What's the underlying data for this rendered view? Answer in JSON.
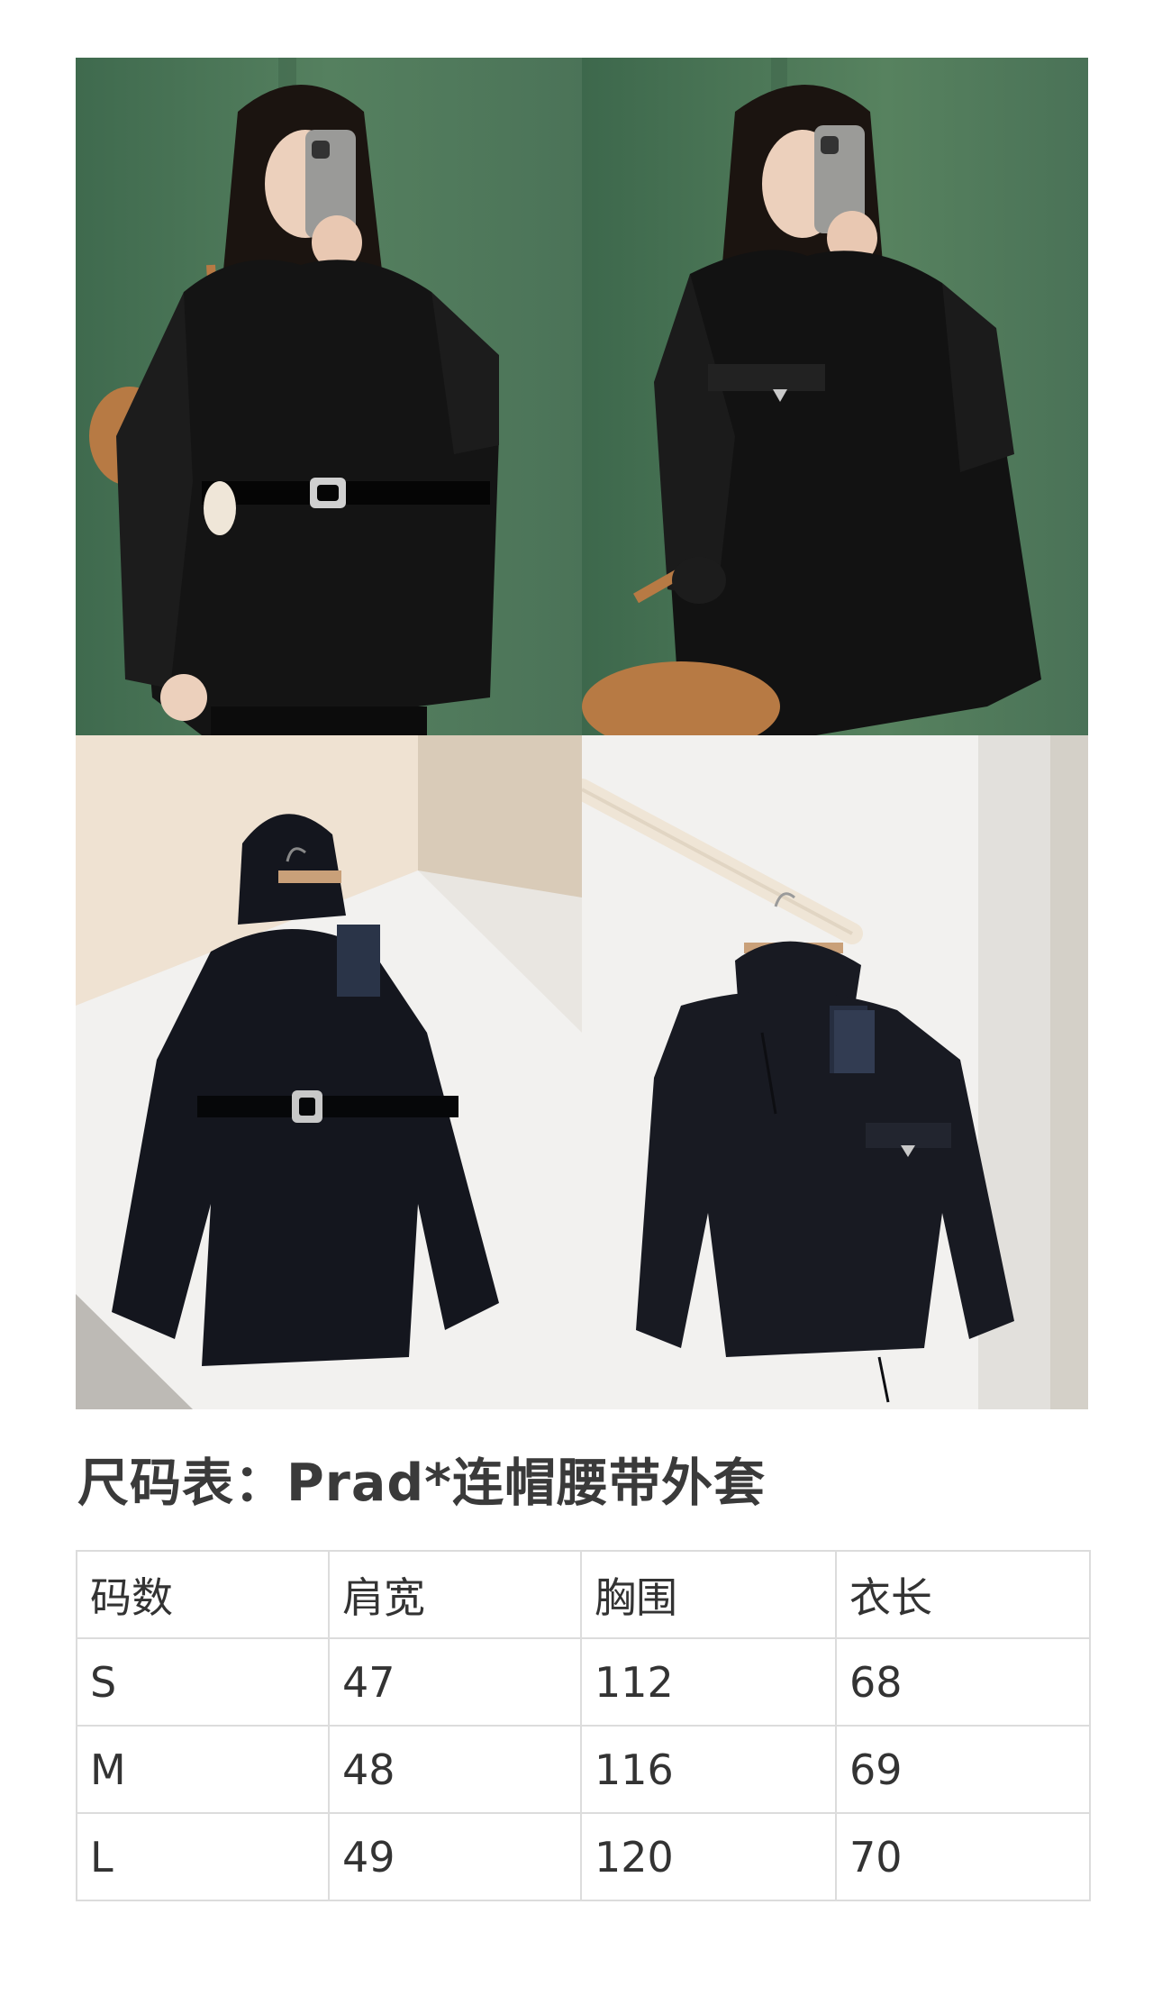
{
  "photos": [
    {
      "name": "photo-model-belted",
      "colors": {
        "bg": "#4b7358",
        "jacket": "#141414",
        "skin": "#e8c9b4",
        "bag": "#b77a44"
      }
    },
    {
      "name": "photo-model-open",
      "colors": {
        "bg": "#4a7257",
        "jacket": "#121212",
        "skin": "#e8c9b4",
        "bag": "#b77a44"
      }
    },
    {
      "name": "photo-hanger-belted",
      "colors": {
        "bg": "#e9e6e1",
        "jacket": "#14161e",
        "floor": "#f0efed"
      }
    },
    {
      "name": "photo-hanger-hooded",
      "colors": {
        "bg": "#f2f1ef",
        "jacket": "#181a22",
        "rail": "#efe5d6"
      }
    }
  ],
  "title": "尺码表：Prad*连帽腰带外套",
  "table": {
    "headers": [
      "码数",
      "肩宽",
      "胸围",
      "衣长"
    ],
    "rows": [
      [
        "S",
        "47",
        "112",
        "68"
      ],
      [
        "M",
        "48",
        "116",
        "69"
      ],
      [
        "L",
        "49",
        "120",
        "70"
      ]
    ]
  },
  "colors": {
    "text": "#333333",
    "border": "#dcdcdc",
    "background": "#ffffff"
  }
}
